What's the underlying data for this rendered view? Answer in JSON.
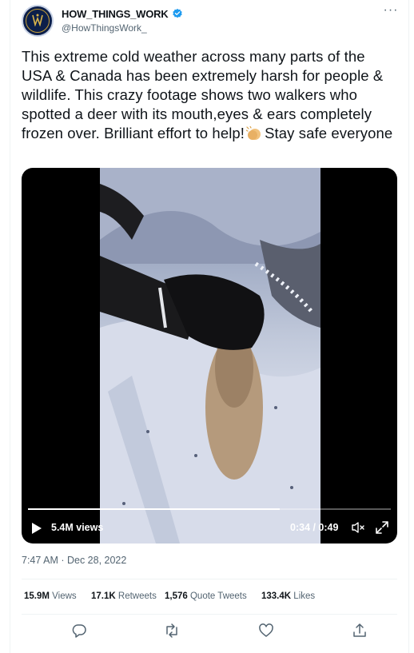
{
  "author": {
    "display_name": "HOW_THINGS_WORK",
    "handle": "@HowThingsWork_",
    "avatar_icon": "how-things-work-logo",
    "verified_color": "#1d9bf0"
  },
  "tweet": {
    "text_before_emoji": "This extreme cold weather across many parts of the USA & Canada has been extremely harsh for people & wildlife. This crazy footage shows two walkers who spotted a deer with its mouth,eyes & ears completely frozen over. Brilliant effort to help!",
    "emoji": "clapping-hands",
    "text_after_emoji": "Stay safe everyone"
  },
  "video": {
    "views": "5.4M views",
    "time": "0:34 / 0:49",
    "progress_fraction": 0.694,
    "icons": [
      "play-icon",
      "mute-icon",
      "expand-icon"
    ]
  },
  "timestamp": "7:47 AM · Dec 28, 2022",
  "stats": {
    "views_value": "15.9M",
    "views_label": "Views",
    "retweets_value": "17.1K",
    "retweets_label": "Retweets",
    "quotes_value": "1,576",
    "quotes_label": "Quote Tweets",
    "likes_value": "133.4K",
    "likes_label": "Likes"
  },
  "actions": [
    "reply-icon",
    "retweet-icon",
    "like-icon",
    "share-icon"
  ],
  "colors": {
    "text": "#0f1419",
    "secondary": "#536471",
    "divider": "#eff3f4",
    "accent": "#1d9bf0"
  }
}
